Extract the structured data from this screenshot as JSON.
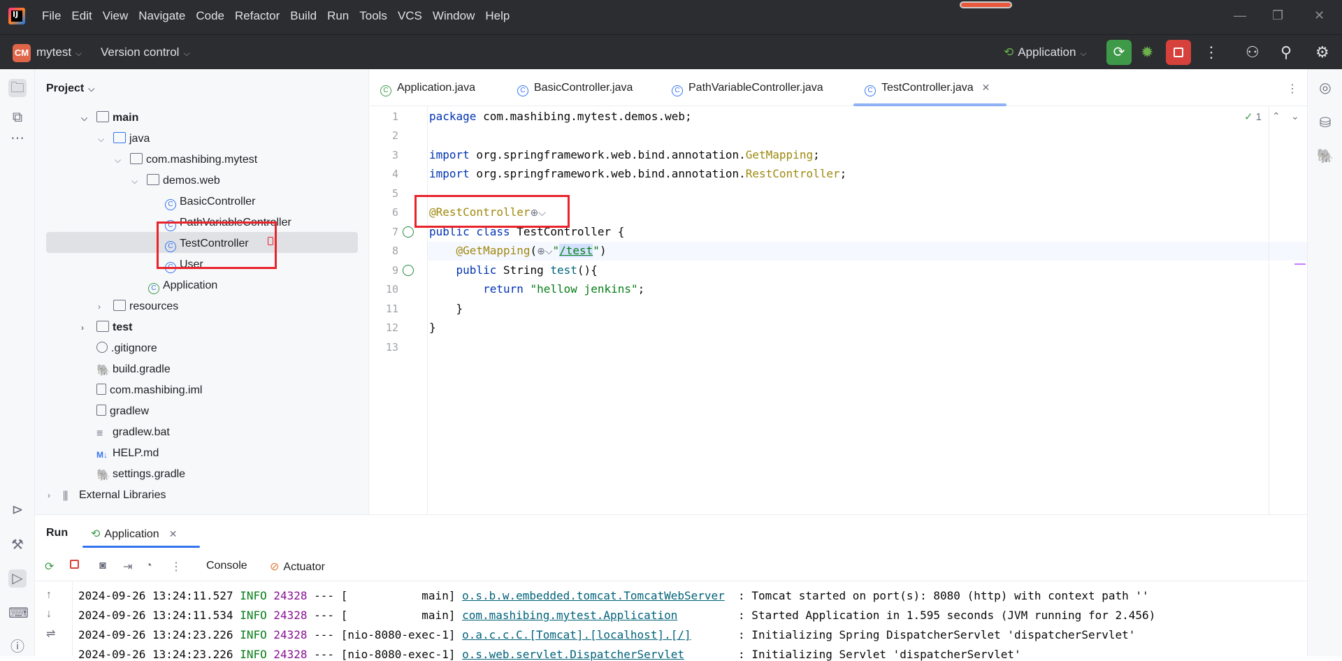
{
  "titlebar": {
    "logo_letter": "IJ",
    "menu": [
      "File",
      "Edit",
      "View",
      "Navigate",
      "Code",
      "Refactor",
      "Build",
      "Run",
      "Tools",
      "VCS",
      "Window",
      "Help"
    ],
    "controls": {
      "minimize": "—",
      "restore": "❐",
      "close": "✕"
    }
  },
  "header": {
    "project_badge": "CM",
    "project_name": "mytest",
    "version_control": "Version control",
    "run_config": "Application"
  },
  "project_panel": {
    "title": "Project",
    "tree": [
      {
        "label": "main",
        "bold": true
      },
      {
        "label": "java"
      },
      {
        "label": "com.mashibing.mytest"
      },
      {
        "label": "demos.web"
      },
      {
        "label": "BasicController"
      },
      {
        "label": "PathVariableController"
      },
      {
        "label": "TestController"
      },
      {
        "label": "User"
      },
      {
        "label": "Application"
      },
      {
        "label": "resources"
      },
      {
        "label": "test",
        "bold": true
      },
      {
        "label": ".gitignore"
      },
      {
        "label": "build.gradle"
      },
      {
        "label": "com.mashibing.iml"
      },
      {
        "label": "gradlew"
      },
      {
        "label": "gradlew.bat"
      },
      {
        "label": "HELP.md"
      },
      {
        "label": "settings.gradle"
      },
      {
        "label": "External Libraries"
      }
    ]
  },
  "tabs": [
    {
      "label": "Application.java"
    },
    {
      "label": "BasicController.java"
    },
    {
      "label": "PathVariableController.java"
    },
    {
      "label": "TestController.java",
      "active": true
    }
  ],
  "editor": {
    "inspection_count": "1",
    "line_numbers": [
      "1",
      "2",
      "3",
      "4",
      "5",
      "6",
      "7",
      "8",
      "9",
      "10",
      "11",
      "12",
      "13"
    ],
    "code": {
      "l1_kw": "package",
      "l1_rest": " com.mashibing.mytest.demos.web;",
      "l3_kw": "import",
      "l3_pkg": " org.springframework.web.bind.annotation.",
      "l3_cls": "GetMapping",
      "l3_end": ";",
      "l4_kw": "import",
      "l4_pkg": " org.springframework.web.bind.annotation.",
      "l4_cls": "RestController",
      "l4_end": ";",
      "l6_ann": "@RestController",
      "l7_kw": "public class",
      "l7_rest": " TestController {",
      "l8_ann": "@GetMapping",
      "l8_open": "(",
      "l8_q1": "\"",
      "l8_path": "/test",
      "l8_q2": "\"",
      "l8_close": ")",
      "l9_kw": "public",
      "l9_type": " String ",
      "l9_fn": "test",
      "l9_rest": "(){",
      "l10_kw": "return",
      "l10_str": " \"hellow jenkins\"",
      "l10_end": ";",
      "l11": "}",
      "l12": "}"
    }
  },
  "run_panel": {
    "title": "Run",
    "tab": "Application",
    "console_tab": "Console",
    "actuator_tab": "Actuator",
    "lines": [
      {
        "ts": "2024-09-26 13:24:11.527",
        "lvl": " INFO ",
        "pid": "24328",
        "mid": " --- [           main] ",
        "logger": "o.s.b.w.embedded.tomcat.TomcatWebServer",
        "msg": "  : Tomcat started on port(s): 8080 (http) with context path ''"
      },
      {
        "ts": "2024-09-26 13:24:11.534",
        "lvl": " INFO ",
        "pid": "24328",
        "mid": " --- [           main] ",
        "logger": "com.mashibing.mytest.Application",
        "msg": "         : Started Application in 1.595 seconds (JVM running for 2.456)"
      },
      {
        "ts": "2024-09-26 13:24:23.226",
        "lvl": " INFO ",
        "pid": "24328",
        "mid": " --- [nio-8080-exec-1] ",
        "logger": "o.a.c.c.C.[Tomcat].[localhost].[/]",
        "msg": "       : Initializing Spring DispatcherServlet 'dispatcherServlet'"
      },
      {
        "ts": "2024-09-26 13:24:23.226",
        "lvl": " INFO ",
        "pid": "24328",
        "mid": " --- [nio-8080-exec-1] ",
        "logger": "o.s.web.servlet.DispatcherServlet",
        "msg": "        : Initializing Servlet 'dispatcherServlet'"
      }
    ]
  },
  "colors": {
    "accent": "#3574f0",
    "run_green": "#3e9a49",
    "stop_red": "#d6413b",
    "highlight_red": "#e8232b"
  }
}
